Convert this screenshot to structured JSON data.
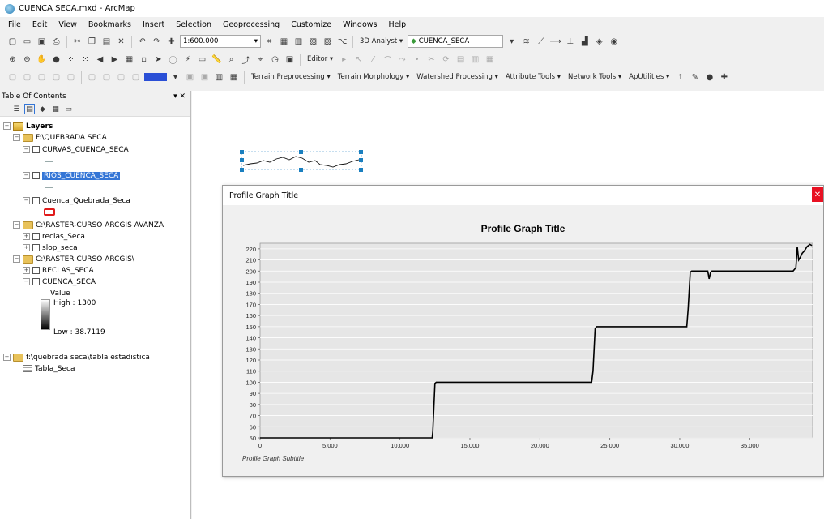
{
  "window": {
    "title": "CUENCA SECA.mxd - ArcMap"
  },
  "menu": [
    "File",
    "Edit",
    "View",
    "Bookmarks",
    "Insert",
    "Selection",
    "Geoprocessing",
    "Customize",
    "Windows",
    "Help"
  ],
  "toolbar": {
    "scale": "1:600.000",
    "analyst_3d": "3D Analyst ▾",
    "layer_select": "CUENCA_SECA",
    "editor": "Editor ▾",
    "ext_menus": [
      "Terrain Preprocessing ▾",
      "Terrain Morphology ▾",
      "Watershed Processing ▾",
      "Attribute Tools ▾",
      "Network Tools ▾",
      "ApUtilities ▾"
    ]
  },
  "toc": {
    "header": "Table Of Contents",
    "pin": "▾ ✕",
    "root": "Layers",
    "items": [
      {
        "label": "F:\\QUEBRADA SECA"
      },
      {
        "label": "CURVAS_CUENCA_SECA"
      },
      {
        "label": "RIOS_CUENCA_SECA"
      },
      {
        "label": "Cuenca_Quebrada_Seca"
      },
      {
        "label": "C:\\RASTER-CURSO ARCGIS AVANZA"
      },
      {
        "label": "reclas_Seca"
      },
      {
        "label": "slop_seca"
      },
      {
        "label": "C:\\RASTER CURSO ARCGIS\\"
      },
      {
        "label": "RECLAS_SECA"
      },
      {
        "label": "CUENCA_SECA"
      },
      {
        "label": "f:\\quebrada seca\\tabla estadistica"
      },
      {
        "label": "Tabla_Seca"
      }
    ],
    "legend": {
      "title": "Value",
      "high": "High : 1300",
      "low": "Low : 38.7119"
    }
  },
  "dialog": {
    "title": "Profile Graph Title",
    "close": "✕"
  },
  "chart_data": {
    "type": "line",
    "title": "Profile Graph Title",
    "subtitle": "Profile Graph Subtitle",
    "xlabel": "",
    "ylabel": "",
    "xlim": [
      0,
      39500
    ],
    "ylim": [
      50,
      225
    ],
    "xticks": [
      0,
      5000,
      10000,
      15000,
      20000,
      25000,
      30000,
      35000
    ],
    "xtick_labels": [
      "0",
      "5,000",
      "10,000",
      "15,000",
      "20,000",
      "25,000",
      "30,000",
      "35,000"
    ],
    "yticks": [
      50,
      60,
      70,
      80,
      90,
      100,
      110,
      120,
      130,
      140,
      150,
      160,
      170,
      180,
      190,
      200,
      210,
      220
    ],
    "grid": true,
    "line_color": "#000000",
    "series": [
      {
        "x": [
          0,
          12300,
          12350,
          12500,
          12600,
          23700,
          23800,
          23950,
          24050,
          30500,
          30600,
          30750,
          30850,
          32000,
          32100,
          32200,
          32300,
          38100,
          38300,
          38400,
          38500,
          38600,
          38750,
          38900,
          39100,
          39300,
          39450
        ],
        "y": [
          50,
          50,
          56,
          99,
          100,
          100,
          110,
          148,
          150,
          150,
          166,
          199,
          200,
          200,
          193,
          199,
          200,
          200,
          203,
          222,
          210,
          212,
          216,
          218,
          222,
          224,
          223
        ]
      }
    ]
  }
}
